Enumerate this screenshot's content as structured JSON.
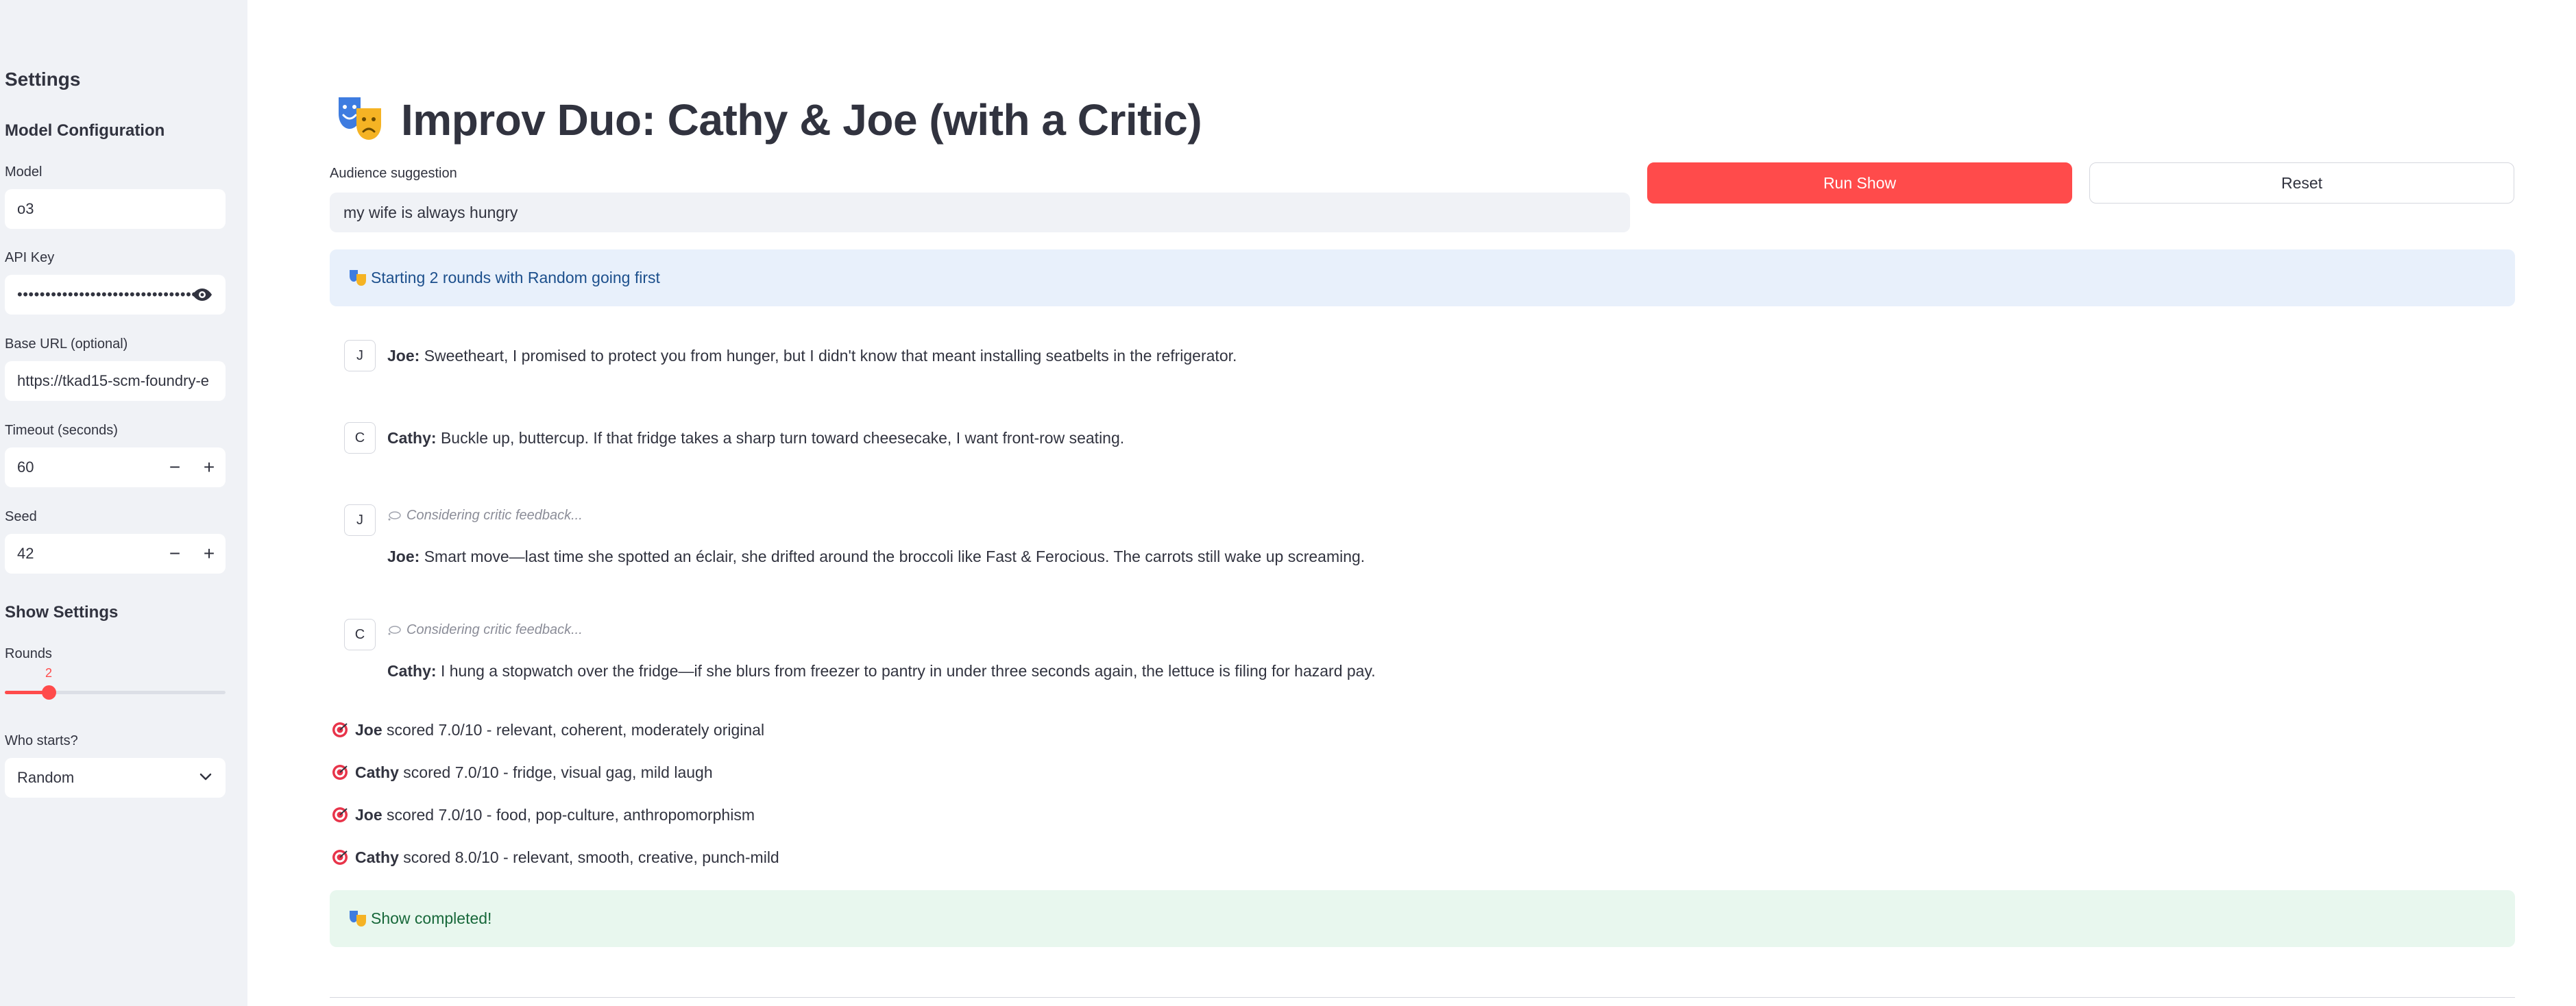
{
  "sidebar": {
    "heading": "Settings",
    "model_config_heading": "Model Configuration",
    "model": {
      "label": "Model",
      "value": "o3"
    },
    "api_key": {
      "label": "API Key",
      "value": "••••••••••••••••••••••••••••••••••"
    },
    "base_url": {
      "label": "Base URL (optional)",
      "value": "https://tkad15-scm-foundry-e"
    },
    "timeout": {
      "label": "Timeout (seconds)",
      "value": "60",
      "minus": "−",
      "plus": "+"
    },
    "seed": {
      "label": "Seed",
      "value": "42",
      "minus": "−",
      "plus": "+"
    },
    "show_settings_heading": "Show Settings",
    "rounds": {
      "label": "Rounds",
      "value": "2",
      "min": 1,
      "max": 10
    },
    "who_starts": {
      "label": "Who starts?",
      "value": "Random"
    }
  },
  "main": {
    "title": "Improv Duo: Cathy & Joe (with a Critic)",
    "suggestion": {
      "label": "Audience suggestion",
      "value": "my wife is always hungry"
    },
    "run_button": "Run Show",
    "reset_button": "Reset",
    "info_alert": "Starting 2 rounds with Random going first",
    "messages": [
      {
        "avatar": "J",
        "speaker": "Joe:",
        "text": "Sweetheart, I promised to protect you from hunger, but I didn't know that meant installing seatbelts in the refrigerator."
      },
      {
        "avatar": "C",
        "speaker": "Cathy:",
        "text": "Buckle up, buttercup. If that fridge takes a sharp turn toward cheesecake, I want front-row seating."
      },
      {
        "avatar": "J",
        "status": "Considering critic feedback...",
        "speaker": "Joe:",
        "text": "Smart move—last time she spotted an éclair, she drifted around the broccoli like Fast & Ferocious. The carrots still wake up screaming."
      },
      {
        "avatar": "C",
        "status": "Considering critic feedback...",
        "speaker": "Cathy:",
        "text": "I hung a stopwatch over the fridge—if she blurs from freezer to pantry in under three seconds again, the lettuce is filing for hazard pay."
      }
    ],
    "scores": [
      {
        "name": "Joe",
        "text": "scored 7.0/10 - relevant, coherent, moderately original"
      },
      {
        "name": "Cathy",
        "text": "scored 7.0/10 - fridge, visual gag, mild laugh"
      },
      {
        "name": "Joe",
        "text": "scored 7.0/10 - food, pop-culture, anthropomorphism"
      },
      {
        "name": "Cathy",
        "text": "scored 8.0/10 - relevant, smooth, creative, punch-mild"
      }
    ],
    "success_alert": "Show completed!"
  },
  "colors": {
    "primary": "#ff4b4b",
    "sidebar_bg": "#f0f2f6",
    "info_bg": "#e8f0fb",
    "success_bg": "#e8f7ee",
    "text": "#31333f"
  }
}
